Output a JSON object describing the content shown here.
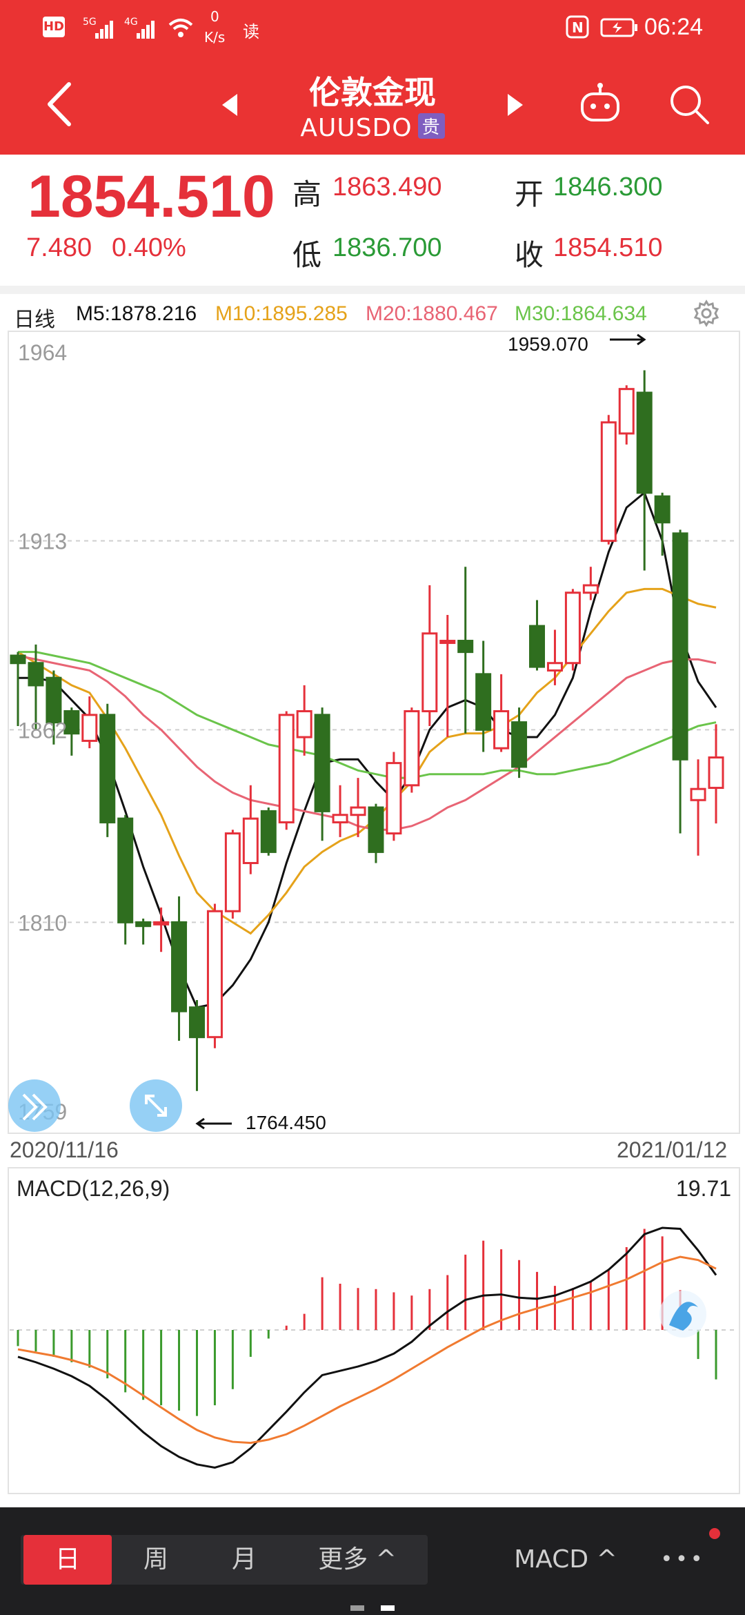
{
  "status_bar": {
    "left_icons": [
      "hd-icon",
      "signal-5g-icon",
      "signal-4g-icon",
      "wifi-icon"
    ],
    "net_speed_value": "0",
    "net_speed_unit": "K/s",
    "read_label": "读",
    "time": "06:24"
  },
  "header": {
    "title": "伦敦金现",
    "symbol": "AUUSDO",
    "badge": "贵"
  },
  "quote": {
    "price": "1854.510",
    "change": "7.480",
    "change_pct": "0.40%",
    "high_label": "高",
    "high": "1863.490",
    "low_label": "低",
    "low": "1836.700",
    "open_label": "开",
    "open": "1846.300",
    "close_label": "收",
    "close": "1854.510"
  },
  "ma_bar": {
    "period": "日线",
    "m5": "M5:1878.216",
    "m10": "M10:1895.285",
    "m20": "M20:1880.467",
    "m30": "M30:1864.634"
  },
  "colors": {
    "header_bg": "#ea3333",
    "up": "#e5303a",
    "down": "#2f6e1f",
    "m5": "#111111",
    "m10": "#e5a21a",
    "m20": "#e86474",
    "m30": "#6ac44a",
    "dea": "#f07a30"
  },
  "chart_data": [
    {
      "type": "candlestick",
      "y_ticks": [
        "1964",
        "1913",
        "1862",
        "1810",
        "1759"
      ],
      "ylim": [
        1759,
        1964
      ],
      "x_start_label": "2020/11/16",
      "x_end_label": "2021/01/12",
      "max_annotation": "1959.070",
      "min_annotation": "1764.450",
      "candles": [
        {
          "o": 1882,
          "c": 1880,
          "h": 1883,
          "l": 1863
        },
        {
          "o": 1880,
          "c": 1874,
          "h": 1885,
          "l": 1862
        },
        {
          "o": 1876,
          "c": 1864,
          "h": 1878,
          "l": 1858
        },
        {
          "o": 1867,
          "c": 1861,
          "h": 1868,
          "l": 1855
        },
        {
          "o": 1859,
          "c": 1866,
          "h": 1871,
          "l": 1857
        },
        {
          "o": 1866,
          "c": 1837,
          "h": 1869,
          "l": 1833
        },
        {
          "o": 1838,
          "c": 1810,
          "h": 1839,
          "l": 1804
        },
        {
          "o": 1810,
          "c": 1809,
          "h": 1811,
          "l": 1804
        },
        {
          "o": 1810,
          "c": 1810,
          "h": 1814,
          "l": 1802
        },
        {
          "o": 1810,
          "c": 1786,
          "h": 1817,
          "l": 1778
        },
        {
          "o": 1787,
          "c": 1779,
          "h": 1789,
          "l": 1764.45
        },
        {
          "o": 1779,
          "c": 1813,
          "h": 1815,
          "l": 1776
        },
        {
          "o": 1813,
          "c": 1834,
          "h": 1835,
          "l": 1811
        },
        {
          "o": 1826,
          "c": 1838,
          "h": 1847,
          "l": 1823
        },
        {
          "o": 1840,
          "c": 1829,
          "h": 1841,
          "l": 1828
        },
        {
          "o": 1837,
          "c": 1866,
          "h": 1867,
          "l": 1835
        },
        {
          "o": 1860,
          "c": 1867,
          "h": 1874,
          "l": 1855
        },
        {
          "o": 1866,
          "c": 1840,
          "h": 1868,
          "l": 1832
        },
        {
          "o": 1837,
          "c": 1839,
          "h": 1847,
          "l": 1833
        },
        {
          "o": 1839,
          "c": 1841,
          "h": 1849,
          "l": 1833
        },
        {
          "o": 1841,
          "c": 1829,
          "h": 1842,
          "l": 1826
        },
        {
          "o": 1834,
          "c": 1853,
          "h": 1856,
          "l": 1832
        },
        {
          "o": 1847,
          "c": 1867,
          "h": 1868,
          "l": 1845
        },
        {
          "o": 1867,
          "c": 1888,
          "h": 1901,
          "l": 1863
        },
        {
          "o": 1886,
          "c": 1886,
          "h": 1893,
          "l": 1860
        },
        {
          "o": 1886,
          "c": 1883,
          "h": 1906,
          "l": 1861
        },
        {
          "o": 1877,
          "c": 1862,
          "h": 1886,
          "l": 1856
        },
        {
          "o": 1857,
          "c": 1867,
          "h": 1877,
          "l": 1856
        },
        {
          "o": 1864,
          "c": 1852,
          "h": 1868,
          "l": 1849
        },
        {
          "o": 1890,
          "c": 1879,
          "h": 1897,
          "l": 1878
        },
        {
          "o": 1878,
          "c": 1880,
          "h": 1889,
          "l": 1874
        },
        {
          "o": 1880,
          "c": 1899,
          "h": 1900,
          "l": 1878
        },
        {
          "o": 1899,
          "c": 1901,
          "h": 1906,
          "l": 1897
        },
        {
          "o": 1913,
          "c": 1945,
          "h": 1947,
          "l": 1912
        },
        {
          "o": 1942,
          "c": 1954,
          "h": 1955,
          "l": 1939
        },
        {
          "o": 1953,
          "c": 1926,
          "h": 1959.07,
          "l": 1905
        },
        {
          "o": 1925,
          "c": 1918,
          "h": 1926,
          "l": 1909
        },
        {
          "o": 1915,
          "c": 1854,
          "h": 1916,
          "l": 1834
        },
        {
          "o": 1843,
          "c": 1846,
          "h": 1854,
          "l": 1828
        },
        {
          "o": 1846.3,
          "c": 1854.51,
          "h": 1863.49,
          "l": 1836.7
        }
      ],
      "series": [
        {
          "name": "M5",
          "color": "#111111",
          "values": [
            1876,
            1876,
            1875,
            1870,
            1865,
            1854,
            1840,
            1825,
            1812,
            1798,
            1787,
            1788,
            1793,
            1800,
            1810,
            1826,
            1840,
            1853,
            1854,
            1854,
            1848,
            1843,
            1850,
            1862,
            1868,
            1870,
            1868,
            1862,
            1860,
            1860,
            1866,
            1876,
            1894,
            1910,
            1922,
            1926,
            1913,
            1888,
            1875,
            1868
          ]
        },
        {
          "name": "M10",
          "color": "#e5a21a",
          "values": [
            1883,
            1880,
            1877,
            1874,
            1872,
            1865,
            1857,
            1848,
            1839,
            1828,
            1818,
            1813,
            1810,
            1807,
            1812,
            1818,
            1825,
            1829,
            1832,
            1834,
            1838,
            1843,
            1848,
            1856,
            1860,
            1861,
            1861,
            1863,
            1866,
            1872,
            1876,
            1882,
            1888,
            1894,
            1899,
            1900,
            1900,
            1898,
            1896,
            1895
          ]
        },
        {
          "name": "M20",
          "color": "#e86474",
          "values": [
            1882,
            1881,
            1880,
            1879,
            1878,
            1875,
            1871,
            1866,
            1862,
            1857,
            1852,
            1848,
            1845,
            1843,
            1842,
            1841,
            1840,
            1839,
            1838,
            1836,
            1835,
            1835,
            1836,
            1838,
            1841,
            1843,
            1846,
            1849,
            1852,
            1856,
            1860,
            1864,
            1868,
            1872,
            1876,
            1878,
            1880,
            1881,
            1881,
            1880
          ]
        },
        {
          "name": "M30",
          "color": "#6ac44a",
          "values": [
            1883,
            1883,
            1882,
            1881,
            1880,
            1878,
            1876,
            1874,
            1872,
            1869,
            1866,
            1864,
            1862,
            1860,
            1858,
            1857,
            1856,
            1855,
            1853,
            1851,
            1850,
            1849,
            1849,
            1850,
            1850,
            1850,
            1850,
            1851,
            1851,
            1850,
            1850,
            1851,
            1852,
            1853,
            1855,
            1857,
            1859,
            1861,
            1863,
            1864
          ]
        }
      ]
    },
    {
      "type": "bar",
      "title": "MACD(12,26,9)",
      "value_label": "19.71",
      "ylim": [
        -14,
        12
      ],
      "histogram": [
        -1.5,
        -2,
        -2.5,
        -3,
        -3.5,
        -4.5,
        -5.8,
        -6.5,
        -7,
        -7.5,
        -8,
        -7,
        -5.5,
        -2.5,
        -0.8,
        0.4,
        1.5,
        4.9,
        4.3,
        3.9,
        3.8,
        3.5,
        3.2,
        3.8,
        5.1,
        7,
        8.3,
        7.5,
        6.5,
        5.4,
        4.1,
        3.9,
        4.5,
        5.6,
        7.7,
        9.4,
        8.7,
        3.7,
        -2.7,
        -4.6
      ],
      "series": [
        {
          "name": "DIF",
          "color": "#111111",
          "values": [
            -2.5,
            -3,
            -3.6,
            -4.3,
            -5.2,
            -6.5,
            -8,
            -9.5,
            -10.8,
            -11.8,
            -12.5,
            -12.8,
            -12.3,
            -11,
            -9.3,
            -7.6,
            -5.8,
            -4.2,
            -3.8,
            -3.4,
            -2.9,
            -2.2,
            -1.1,
            0.4,
            1.7,
            2.8,
            3.2,
            3.3,
            3,
            2.9,
            3.2,
            3.8,
            4.5,
            5.6,
            7.1,
            8.9,
            9.5,
            9.4,
            7.4,
            5.1
          ]
        },
        {
          "name": "DEA",
          "color": "#f07a30",
          "values": [
            -1.8,
            -2.1,
            -2.4,
            -2.8,
            -3.3,
            -4,
            -5,
            -6.1,
            -7.2,
            -8.3,
            -9.3,
            -10,
            -10.4,
            -10.5,
            -10.2,
            -9.7,
            -8.9,
            -8,
            -7.1,
            -6.3,
            -5.5,
            -4.6,
            -3.6,
            -2.6,
            -1.6,
            -0.7,
            0.2,
            0.9,
            1.5,
            2,
            2.5,
            3,
            3.5,
            4.1,
            4.7,
            5.5,
            6.3,
            6.8,
            6.5,
            5.7
          ]
        }
      ]
    }
  ],
  "bottom_bar": {
    "tabs": [
      "日",
      "周",
      "月",
      "更多 ^"
    ],
    "indicator": "MACD ^",
    "more_dots": "•••"
  }
}
